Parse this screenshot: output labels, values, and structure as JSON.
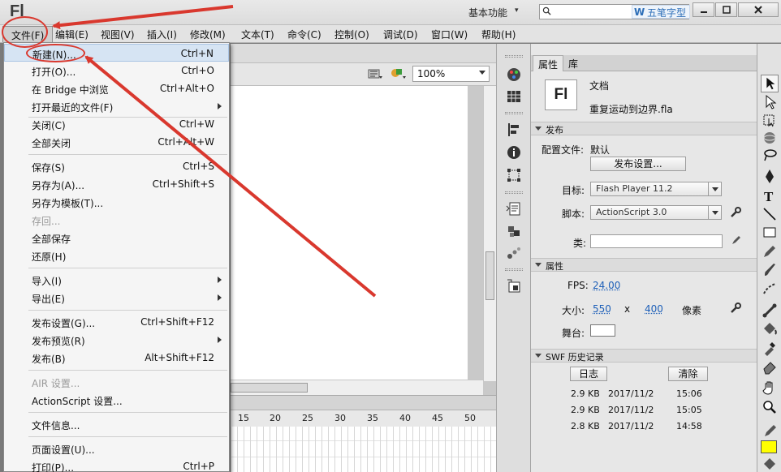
{
  "app": {
    "logo": "Fl",
    "workspace": "基本功能",
    "brand_watermark": "五笔字型"
  },
  "menubar": [
    "文件(F)",
    "编辑(E)",
    "视图(V)",
    "插入(I)",
    "修改(M)",
    "文本(T)",
    "命令(C)",
    "控制(O)",
    "调试(D)",
    "窗口(W)",
    "帮助(H)"
  ],
  "file_menu": {
    "items": [
      {
        "label": "新建(N)...",
        "shortcut": "Ctrl+N"
      },
      {
        "label": "打开(O)...",
        "shortcut": "Ctrl+O"
      },
      {
        "label": "在 Bridge 中浏览",
        "shortcut": "Ctrl+Alt+O"
      },
      {
        "label": "打开最近的文件(F)",
        "shortcut": ""
      },
      {
        "label": "关闭(C)",
        "shortcut": "Ctrl+W"
      },
      {
        "label": "全部关闭",
        "shortcut": "Ctrl+Alt+W"
      },
      {
        "label": "保存(S)",
        "shortcut": "Ctrl+S"
      },
      {
        "label": "另存为(A)...",
        "shortcut": "Ctrl+Shift+S"
      },
      {
        "label": "另存为模板(T)...",
        "shortcut": ""
      },
      {
        "label": "存回...",
        "shortcut": ""
      },
      {
        "label": "全部保存",
        "shortcut": ""
      },
      {
        "label": "还原(H)",
        "shortcut": ""
      },
      {
        "label": "导入(I)",
        "shortcut": ""
      },
      {
        "label": "导出(E)",
        "shortcut": ""
      },
      {
        "label": "发布设置(G)...",
        "shortcut": "Ctrl+Shift+F12"
      },
      {
        "label": "发布预览(R)",
        "shortcut": ""
      },
      {
        "label": "发布(B)",
        "shortcut": "Alt+Shift+F12"
      },
      {
        "label": "AIR 设置...",
        "shortcut": ""
      },
      {
        "label": "ActionScript 设置...",
        "shortcut": ""
      },
      {
        "label": "文件信息...",
        "shortcut": ""
      },
      {
        "label": "页面设置(U)...",
        "shortcut": ""
      },
      {
        "label": "打印(P)...",
        "shortcut": "Ctrl+P"
      }
    ]
  },
  "doc": {
    "zoom": "100%"
  },
  "timeline": {
    "ticks": [
      "15",
      "20",
      "25",
      "30",
      "35",
      "40",
      "45",
      "50"
    ]
  },
  "properties": {
    "tabs": [
      "属性",
      "库"
    ],
    "doc_icon": "Fl",
    "doc_type": "文档",
    "file_name": "重复运动到边界.fla",
    "publish_section": "发布",
    "profile_label": "配置文件:",
    "profile_value": "默认",
    "publish_settings_btn": "发布设置...",
    "target_label": "目标:",
    "target_value": "Flash Player 11.2",
    "script_label": "脚本:",
    "script_value": "ActionScript 3.0",
    "class_label": "类:",
    "props_section": "属性",
    "fps_label": "FPS:",
    "fps_value": "24.00",
    "size_label": "大小:",
    "width": "550",
    "x": "x",
    "height": "400",
    "unit": "像素",
    "stage_label": "舞台:",
    "swf_section": "SWF 历史记录",
    "log_btn": "日志",
    "clear_btn": "清除",
    "history": [
      {
        "size": "2.9 KB",
        "date": "2017/11/2",
        "time": "15:06"
      },
      {
        "size": "2.9 KB",
        "date": "2017/11/2",
        "time": "15:05"
      },
      {
        "size": "2.8 KB",
        "date": "2017/11/2",
        "time": "14:58"
      }
    ]
  },
  "colors": {
    "annotation_red": "#d9382e",
    "fill_color": "#ffff00"
  }
}
